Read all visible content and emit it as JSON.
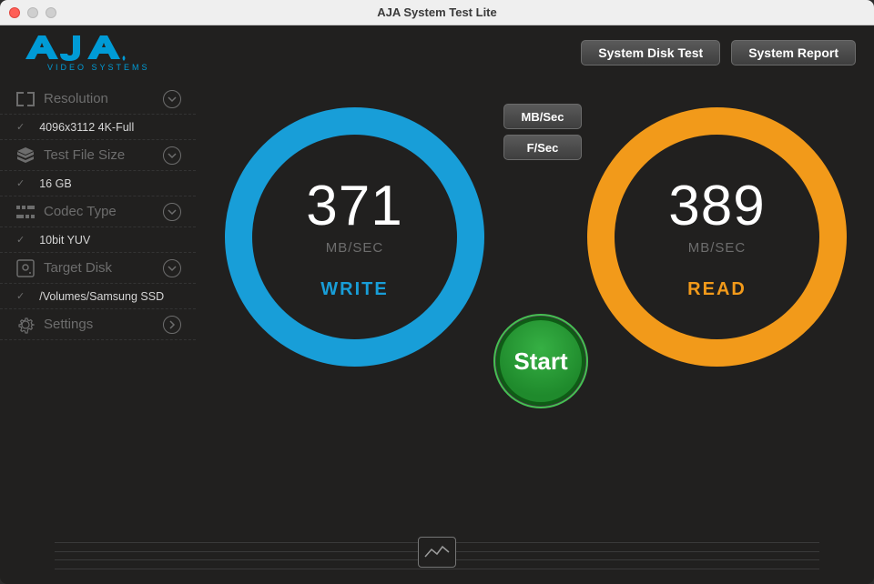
{
  "window": {
    "title": "AJA System Test Lite"
  },
  "logo": {
    "sub": "VIDEO SYSTEMS"
  },
  "top_buttons": {
    "disk_test": "System Disk Test",
    "report": "System Report"
  },
  "sidebar": {
    "resolution": {
      "label": "Resolution",
      "value": "4096x3112 4K-Full"
    },
    "filesize": {
      "label": "Test File Size",
      "value": "16 GB"
    },
    "codec": {
      "label": "Codec Type",
      "value": "10bit YUV"
    },
    "disk": {
      "label": "Target Disk",
      "value": "/Volumes/Samsung SSD"
    },
    "settings": {
      "label": "Settings"
    }
  },
  "units": {
    "mbs": "MB/Sec",
    "fs": "F/Sec"
  },
  "gauges": {
    "write": {
      "value": "371",
      "unit": "MB/SEC",
      "label": "WRITE"
    },
    "read": {
      "value": "389",
      "unit": "MB/SEC",
      "label": "READ"
    }
  },
  "start": {
    "label": "Start"
  }
}
